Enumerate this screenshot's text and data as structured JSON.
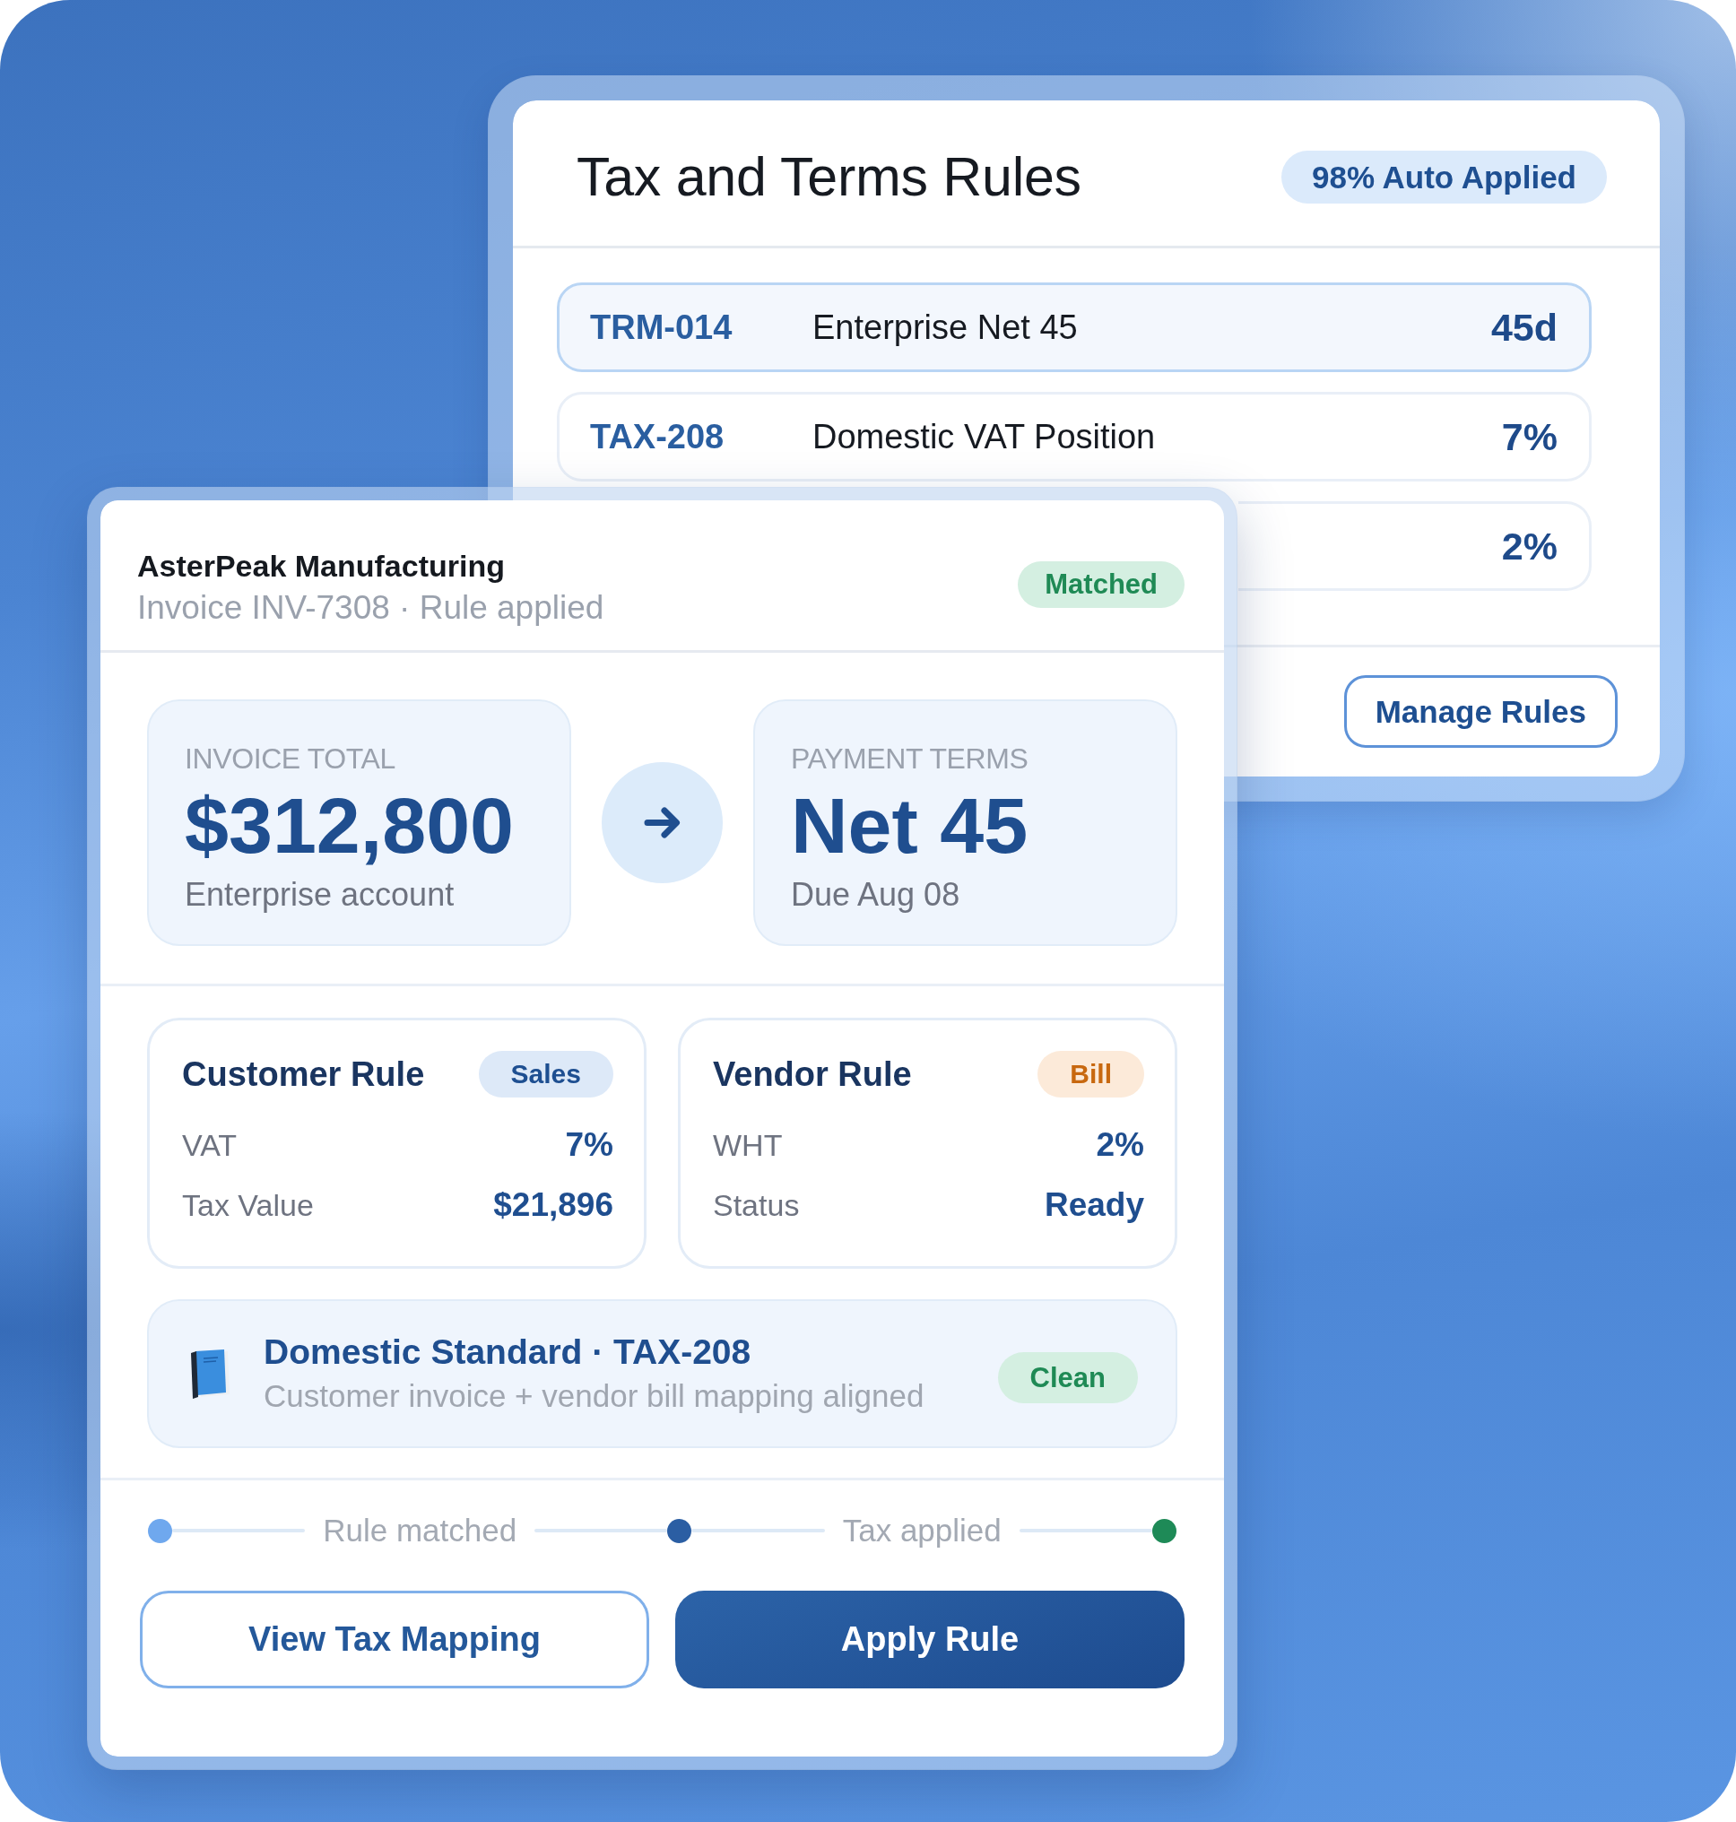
{
  "rules_panel": {
    "title": "Tax and Terms Rules",
    "badge": "98% Auto Applied",
    "rows": [
      {
        "code": "TRM-014",
        "name": "Enterprise Net 45",
        "value": "45d",
        "selected": true
      },
      {
        "code": "TAX-208",
        "name": "Domestic VAT Position",
        "value": "7%",
        "selected": false
      },
      {
        "value": "2%",
        "selected": false
      }
    ],
    "button": "Manage Rules"
  },
  "invoice_card": {
    "customer": "AsterPeak Manufacturing",
    "subtitle": "Invoice INV-7308 · Rule applied",
    "status": "Matched",
    "stats": [
      {
        "label": "INVOICE TOTAL",
        "value": "$312,800",
        "note": "Enterprise account"
      },
      {
        "label": "PAYMENT TERMS",
        "value": "Net 45",
        "note": "Due Aug 08"
      }
    ],
    "rule_cards": [
      {
        "title": "Customer Rule",
        "tag": {
          "text": "Sales",
          "color": "#1e4f91"
        },
        "lines": [
          {
            "label": "VAT",
            "value": "7%"
          },
          {
            "label": "Tax Value",
            "value": "$21,896"
          }
        ]
      },
      {
        "title": "Vendor Rule",
        "tag": {
          "text": "Bill",
          "color": "#c8680f"
        },
        "lines": [
          {
            "label": "WHT",
            "value": "2%"
          },
          {
            "label": "Status",
            "value": "Ready"
          }
        ]
      }
    ],
    "mapping": {
      "title": "Domestic Standard · TAX-208",
      "description": "Customer invoice + vendor bill mapping aligned",
      "status": "Clean"
    },
    "progress": [
      {
        "kind": "dot",
        "color": "#6fa8ee"
      },
      {
        "kind": "label",
        "text": "Rule matched"
      },
      {
        "kind": "dot",
        "color": "#2b5ea3"
      },
      {
        "kind": "label",
        "text": "Tax applied"
      },
      {
        "kind": "dot",
        "color": "#1e8a57"
      }
    ],
    "buttons": [
      {
        "label": "View Tax Mapping",
        "kind": "secondary"
      },
      {
        "label": "Apply Rule",
        "kind": "primary"
      }
    ]
  }
}
